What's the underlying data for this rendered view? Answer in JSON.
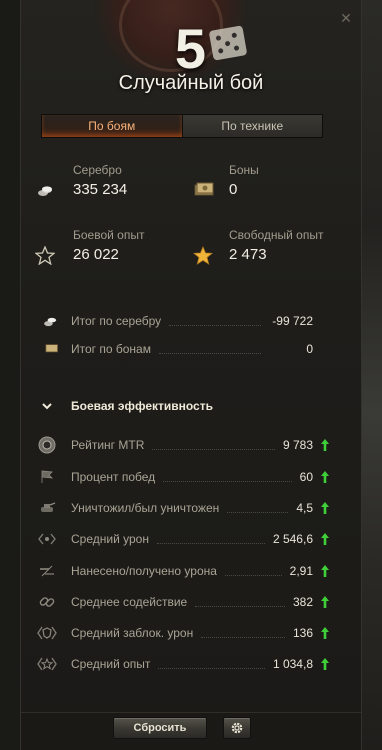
{
  "header": {
    "level": "5",
    "title": "Случайный бой",
    "close_icon": "close-icon"
  },
  "tabs": [
    {
      "label": "По боям",
      "active": true
    },
    {
      "label": "По технике",
      "active": false
    }
  ],
  "stats": {
    "silver": {
      "label": "Серебро",
      "value": "335 234",
      "icon": "silver-coins-icon"
    },
    "bonds": {
      "label": "Боны",
      "value": "0",
      "icon": "bonds-icon"
    },
    "combat_xp": {
      "label": "Боевой опыт",
      "value": "26 022",
      "icon": "star-outline-icon"
    },
    "free_xp": {
      "label": "Свободный опыт",
      "value": "2 473",
      "icon": "star-gold-icon"
    }
  },
  "summary": [
    {
      "label": "Итог по серебру",
      "value": "-99 722",
      "icon": "silver-coins-icon"
    },
    {
      "label": "Итог по бонам",
      "value": "0",
      "icon": "bonds-icon"
    }
  ],
  "efficiency": {
    "title": "Боевая эффективность",
    "rows": [
      {
        "label": "Рейтинг MTR",
        "value": "9 783",
        "icon": "mtr-rating-icon"
      },
      {
        "label": "Процент побед",
        "value": "60",
        "icon": "flag-icon"
      },
      {
        "label": "Уничтожил/был уничтожен",
        "value": "4,5",
        "icon": "destroyed-tank-icon"
      },
      {
        "label": "Средний урон",
        "value": "2 546,6",
        "icon": "damage-icon"
      },
      {
        "label": "Нанесено/получено урона",
        "value": "2,91",
        "icon": "damage-ratio-icon"
      },
      {
        "label": "Среднее содействие",
        "value": "382",
        "icon": "assist-icon"
      },
      {
        "label": "Средний заблок. урон",
        "value": "136",
        "icon": "blocked-damage-icon"
      },
      {
        "label": "Средний опыт",
        "value": "1 034,8",
        "icon": "avg-xp-icon"
      }
    ]
  },
  "colors": {
    "accent_orange": "#f8b279",
    "trend_up": "#3fcf38",
    "gold_star": "#f0b43a"
  },
  "footer": {
    "reset_label": "Сбросить",
    "settings_icon": "gear-icon"
  }
}
